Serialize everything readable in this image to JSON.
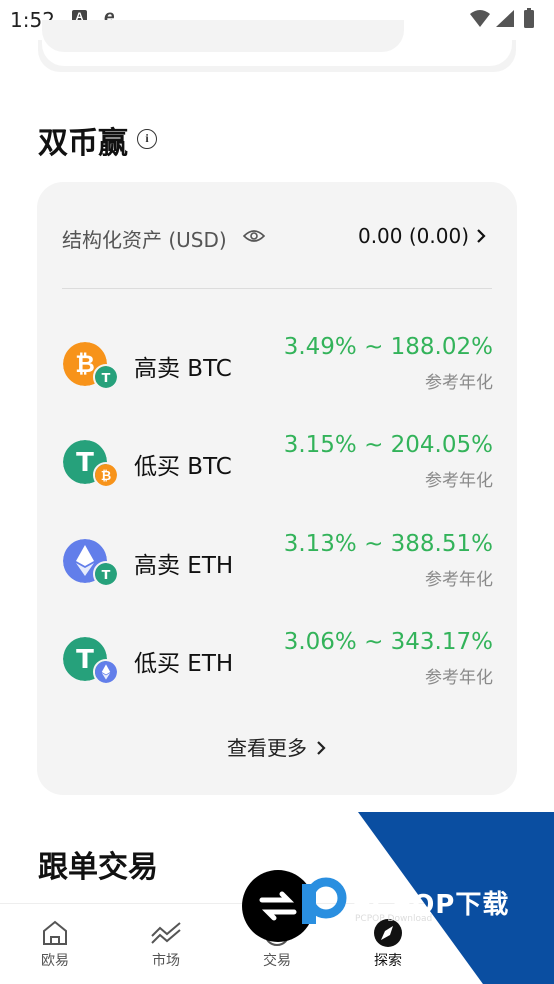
{
  "status_bar": {
    "time": "1:52",
    "a_icon": "A"
  },
  "dual_coin": {
    "title": "双币赢",
    "asset_label": "结构化资产 (USD)",
    "asset_value": "0.00 (0.00)",
    "products": [
      {
        "name": "高卖 BTC",
        "rate": "3.49% ~ 188.02%",
        "sub": "参考年化",
        "big_coin": "btc",
        "small_coin": "usdt"
      },
      {
        "name": "低买 BTC",
        "rate": "3.15% ~ 204.05%",
        "sub": "参考年化",
        "big_coin": "usdt",
        "small_coin": "btc"
      },
      {
        "name": "高卖 ETH",
        "rate": "3.13% ~ 388.51%",
        "sub": "参考年化",
        "big_coin": "eth",
        "small_coin": "usdt"
      },
      {
        "name": "低买 ETH",
        "rate": "3.06% ~ 343.17%",
        "sub": "参考年化",
        "big_coin": "usdt",
        "small_coin": "eth"
      }
    ],
    "view_more": "查看更多"
  },
  "copy_trading": {
    "title": "跟单交易"
  },
  "bottom_nav": {
    "items": [
      {
        "label": "欧易",
        "icon": "home-icon"
      },
      {
        "label": "市场",
        "icon": "market-icon"
      },
      {
        "label": "交易",
        "icon": "trade-icon"
      },
      {
        "label": "探索",
        "icon": "explore-icon",
        "active": true
      }
    ]
  },
  "watermark": {
    "brand": "PCPOP下载",
    "sub": "PCPOP Download"
  },
  "colors": {
    "green": "#33b35a",
    "btc": "#f7931a",
    "usdt": "#26a17b",
    "eth": "#627eea",
    "card": "#f4f4f4"
  }
}
